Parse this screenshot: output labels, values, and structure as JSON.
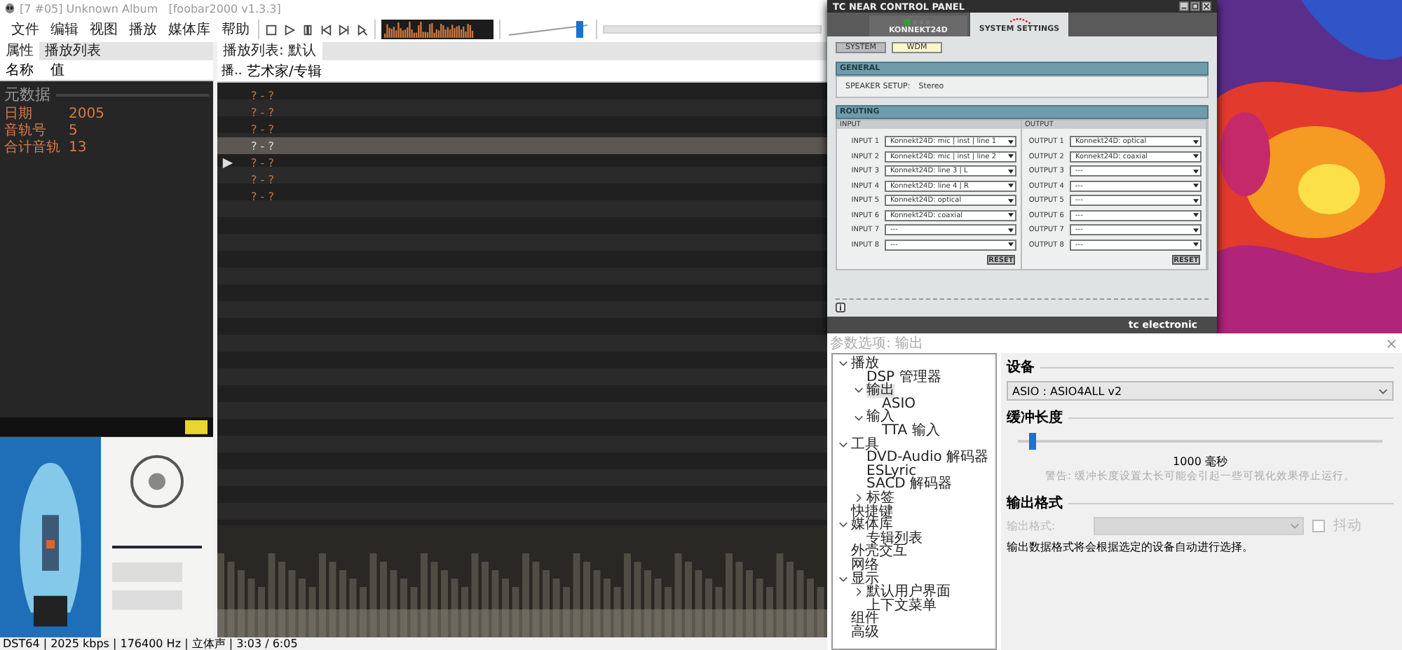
{
  "player": {
    "title": "[7 #05] Unknown Album   [foobar2000 v1.3.3]",
    "menu": [
      "文件",
      "编辑",
      "视图",
      "播放",
      "媒体库",
      "帮助"
    ],
    "volume": {
      "level": 0.92
    },
    "left_tabs": [
      {
        "label": "属性",
        "selected": true
      },
      {
        "label": "播放列表",
        "selected": false
      }
    ],
    "playlist_tab": {
      "label": "播放列表:",
      "name": "默认"
    },
    "properties": {
      "columns": [
        "名称",
        "值"
      ],
      "group": "元数据",
      "rows": [
        {
          "name": "日期",
          "value": "2005"
        },
        {
          "name": "音轨号",
          "value": "5"
        },
        {
          "name": "合计音轨",
          "value": "13"
        }
      ]
    },
    "playlist": {
      "columns": [
        "播..",
        "艺术家/专辑"
      ],
      "rows": [
        {
          "text": "? - ?",
          "selected": false,
          "playing": false
        },
        {
          "text": "? - ?",
          "selected": false,
          "playing": false
        },
        {
          "text": "? - ?",
          "selected": false,
          "playing": false
        },
        {
          "text": "? - ?",
          "selected": true,
          "playing": false
        },
        {
          "text": "? - ?",
          "selected": false,
          "playing": true
        },
        {
          "text": "? - ?",
          "selected": false,
          "playing": false
        },
        {
          "text": "? - ?",
          "selected": false,
          "playing": false
        }
      ]
    },
    "album_art": {
      "kind": "picture"
    },
    "status_bar": "DST64 | 2025 kbps | 176400 Hz | 立体声 | 3:03 / 6:05"
  },
  "control_panel": {
    "title": "TC NEAR CONTROL PANEL",
    "tabs": [
      {
        "label": "KONNEKT24D",
        "selected": false
      },
      {
        "label": "SYSTEM SETTINGS",
        "selected": true
      }
    ],
    "subtabs": [
      {
        "label": "SYSTEM",
        "selected": false
      },
      {
        "label": "WDM",
        "selected": true
      }
    ],
    "general": {
      "heading": "GENERAL",
      "label": "SPEAKER SETUP:",
      "value": "Stereo"
    },
    "routing": {
      "heading": "ROUTING",
      "columns": [
        {
          "heading": "INPUT",
          "reset": "RESET",
          "rows": [
            {
              "label": "INPUT 1",
              "value": "Konnekt24D: mic | inst | line 1"
            },
            {
              "label": "INPUT 2",
              "value": "Konnekt24D: mic | inst | line 2"
            },
            {
              "label": "INPUT 3",
              "value": "Konnekt24D: line 3 | L"
            },
            {
              "label": "INPUT 4",
              "value": "Konnekt24D: line 4 | R"
            },
            {
              "label": "INPUT 5",
              "value": "Konnekt24D: optical"
            },
            {
              "label": "INPUT 6",
              "value": "Konnekt24D: coaxial"
            },
            {
              "label": "INPUT 7",
              "value": "---"
            },
            {
              "label": "INPUT 8",
              "value": "---"
            }
          ]
        },
        {
          "heading": "OUTPUT",
          "reset": "RESET",
          "rows": [
            {
              "label": "OUTPUT 1",
              "value": "Konnekt24D: optical"
            },
            {
              "label": "OUTPUT 2",
              "value": "Konnekt24D: coaxial"
            },
            {
              "label": "OUTPUT 3",
              "value": "---"
            },
            {
              "label": "OUTPUT 4",
              "value": "---"
            },
            {
              "label": "OUTPUT 5",
              "value": "---"
            },
            {
              "label": "OUTPUT 6",
              "value": "---"
            },
            {
              "label": "OUTPUT 7",
              "value": "---"
            },
            {
              "label": "OUTPUT 8",
              "value": "---"
            }
          ]
        }
      ]
    },
    "brand": "tc electronic"
  },
  "wallpaper": {
    "kind": "picture"
  },
  "preferences": {
    "title": "参数选项: 输出",
    "tree": [
      {
        "label": "播放",
        "expanded": true,
        "selected": false,
        "children": [
          {
            "label": "DSP 管理器",
            "selected": false
          },
          {
            "label": "输出",
            "expanded": true,
            "selected": true,
            "children": [
              {
                "label": "ASIO",
                "selected": false
              }
            ]
          },
          {
            "label": "输入",
            "expanded": true,
            "selected": false,
            "children": [
              {
                "label": "TTA 输入",
                "selected": false
              }
            ]
          }
        ]
      },
      {
        "label": "工具",
        "expanded": true,
        "selected": false,
        "children": [
          {
            "label": "DVD-Audio 解码器",
            "selected": false
          },
          {
            "label": "ESLyric",
            "selected": false
          },
          {
            "label": "SACD 解码器",
            "selected": false
          },
          {
            "label": "标签",
            "expanded": false,
            "selected": false
          }
        ]
      },
      {
        "label": "快捷键",
        "selected": false
      },
      {
        "label": "媒体库",
        "expanded": true,
        "selected": false,
        "children": [
          {
            "label": "专辑列表",
            "selected": false
          }
        ]
      },
      {
        "label": "外壳交互",
        "selected": false
      },
      {
        "label": "网络",
        "selected": false
      },
      {
        "label": "显示",
        "expanded": true,
        "selected": false,
        "children": [
          {
            "label": "默认用户界面",
            "expanded": false,
            "selected": false
          },
          {
            "label": "上下文菜单",
            "selected": false
          }
        ]
      },
      {
        "label": "组件",
        "selected": false
      },
      {
        "label": "高级",
        "selected": false
      }
    ],
    "device": {
      "heading": "设备",
      "value": "ASIO : ASIO4ALL v2"
    },
    "buffer": {
      "heading": "缓冲长度",
      "level": 0.03,
      "reading": "1000 毫秒",
      "warning": "警告: 缓冲长度设置太长可能会引起一些可视化效果停止运行。"
    },
    "format": {
      "heading": "输出格式",
      "label": "输出格式:",
      "disabled": true,
      "dither": {
        "label": "抖动",
        "checked": false
      },
      "note": "输出数据格式将会根据选定的设备自动进行选择。"
    }
  }
}
